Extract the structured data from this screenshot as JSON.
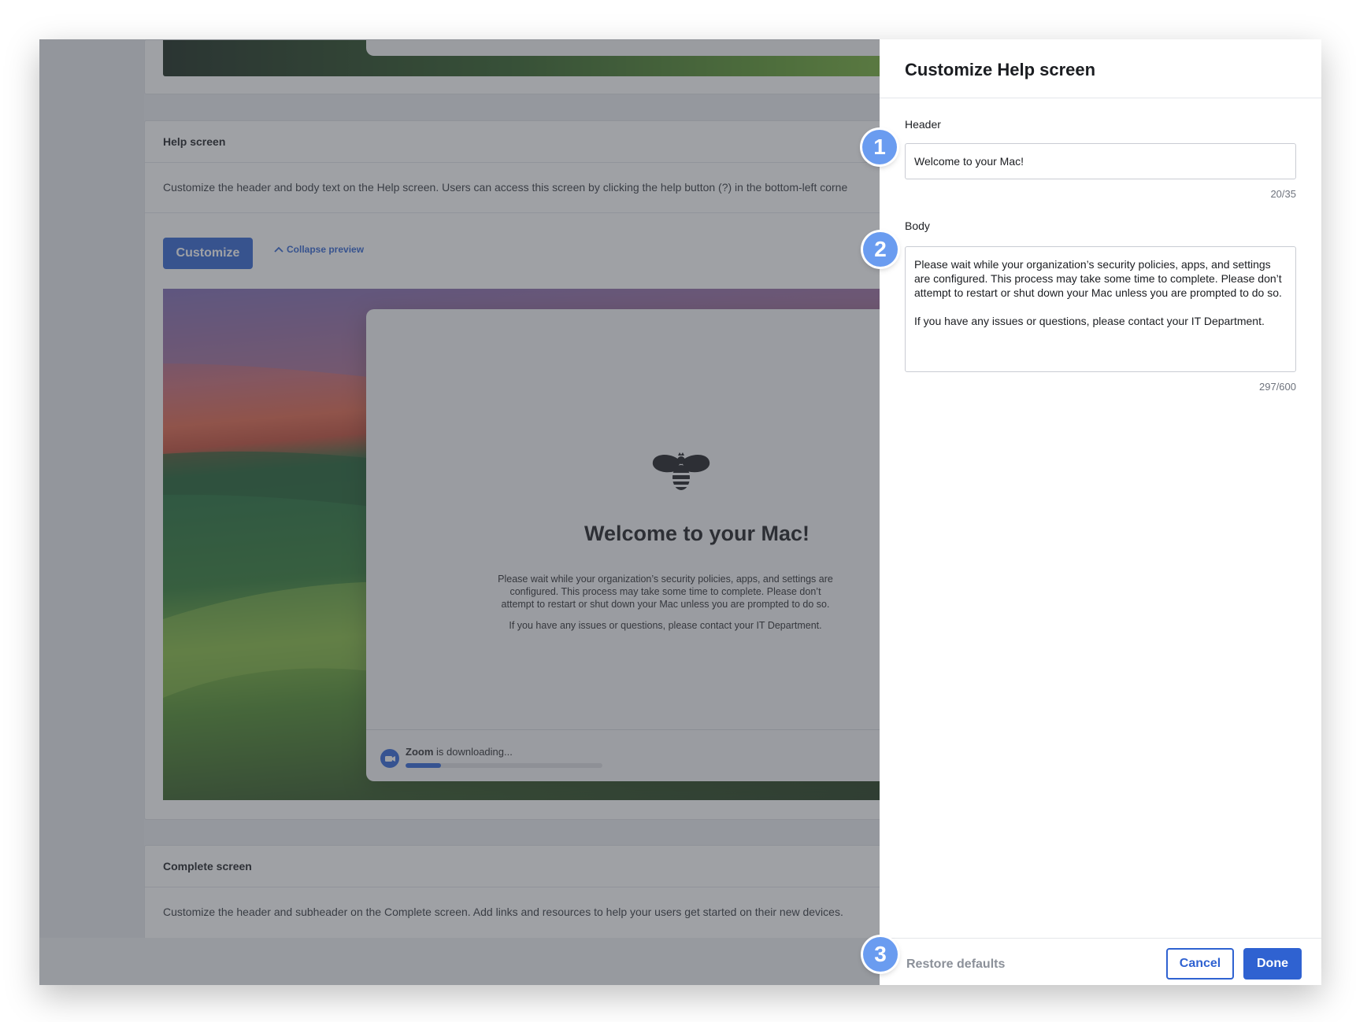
{
  "background": {
    "help_card": {
      "title": "Help screen",
      "description": "Customize the header and body text on the Help screen. Users can access this screen by clicking the help button (?) in the bottom-left corne",
      "customize_label": "Customize",
      "collapse_label": "Collapse preview"
    },
    "preview": {
      "logo_icon": "bee-logo-icon",
      "title": "Welcome to your Mac!",
      "body_1": "Please wait while your organization’s security policies, apps, and settings are configured. This process may take some time to complete. Please don’t attempt to restart or shut down your Mac unless you are prompted to do so.",
      "body_2": "If you have any issues or questions, please contact your IT Department.",
      "download_app": "Zoom",
      "download_text": " is downloading...",
      "download_progress": 0.18
    },
    "complete_card": {
      "title": "Complete screen",
      "description": "Customize the header and subheader on the Complete screen. Add links and resources to help your users get started on their new devices."
    }
  },
  "drawer": {
    "title": "Customize Help screen",
    "header_label": "Header",
    "header_value": "Welcome to your Mac!",
    "header_counter": "20/35",
    "body_label": "Body",
    "body_value": "Please wait while your organization’s security policies, apps, and settings are configured. This process may take some time to complete. Please don’t attempt to restart or shut down your Mac unless you are prompted to do so.\n\nIf you have any issues or questions, please contact your IT Department.",
    "body_counter": "297/600",
    "restore_label": "Restore defaults",
    "cancel_label": "Cancel",
    "done_label": "Done"
  },
  "markers": [
    "1",
    "2",
    "3"
  ],
  "colors": {
    "accent": "#2f62d1",
    "marker": "#6a9cf0"
  }
}
